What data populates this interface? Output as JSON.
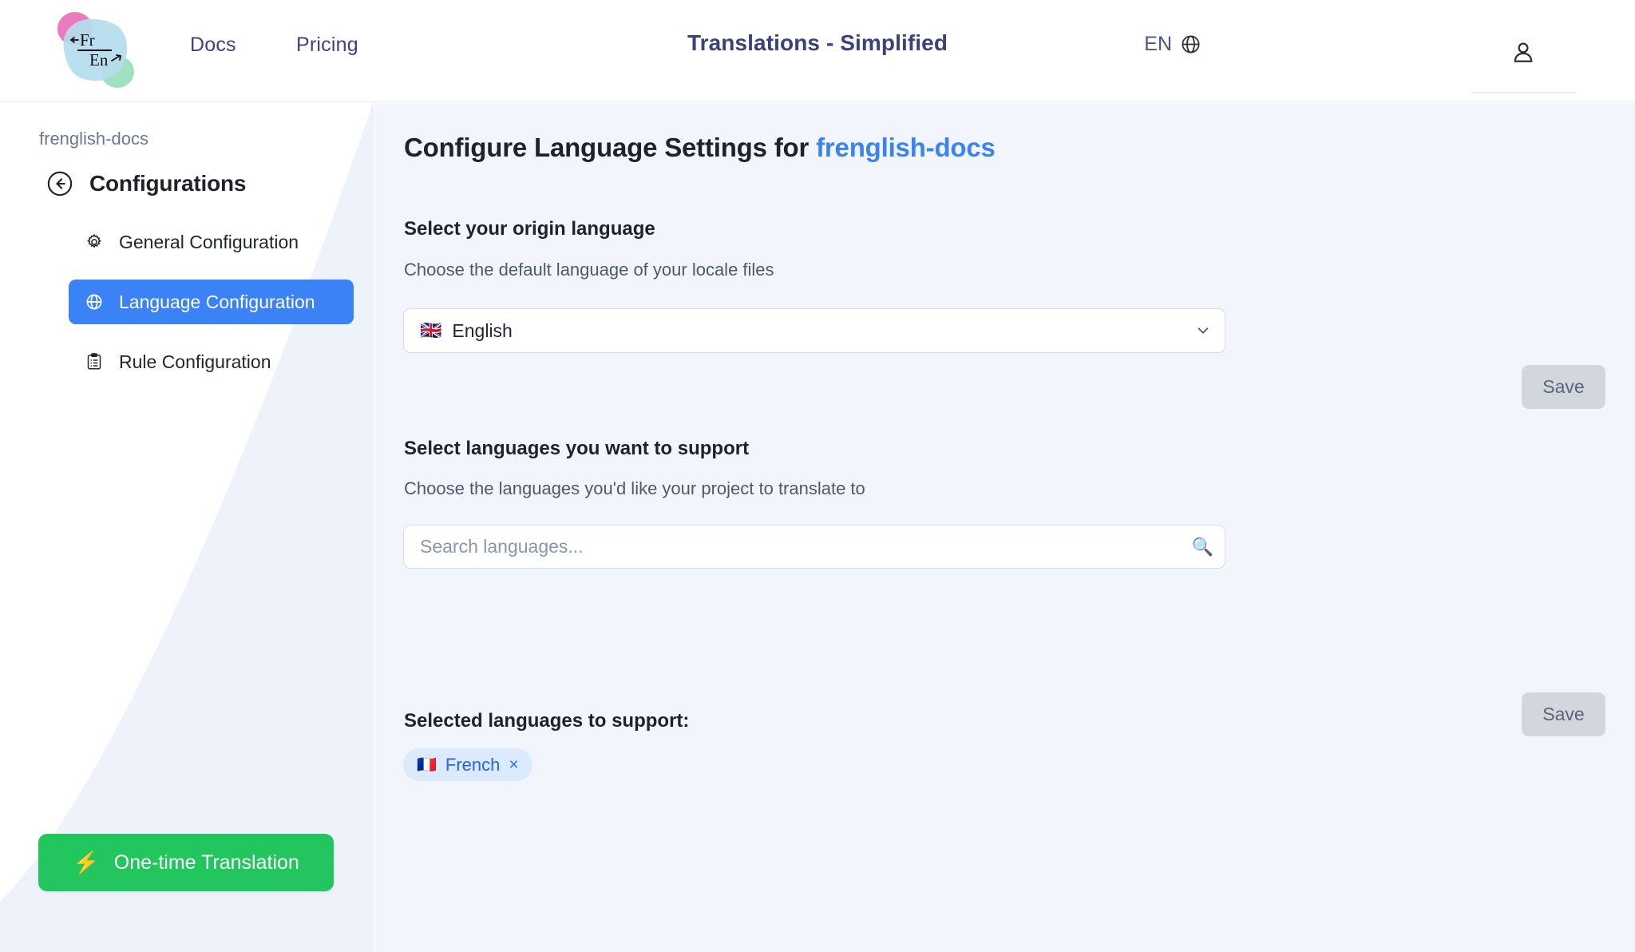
{
  "header": {
    "logo": {
      "name": "frenglish-logo",
      "numerator": "Fr",
      "denominator": "En",
      "blob_main_color": "#b4dced",
      "blob_pink_color": "#ea70b7",
      "blob_green_color": "#a8e0c0"
    },
    "nav": [
      {
        "label": "Docs",
        "name": "nav-docs"
      },
      {
        "label": "Pricing",
        "name": "nav-pricing"
      }
    ],
    "title": "Translations - Simplified",
    "title_color": "#3b4279",
    "language_switcher": {
      "label": "EN",
      "icon": "globe-icon"
    },
    "account": {
      "icon": "user-icon"
    }
  },
  "sidebar": {
    "breadcrumb": "frenglish-docs",
    "heading": "Configurations",
    "back_icon": "arrow-left-circle-icon",
    "items": [
      {
        "label": "General Configuration",
        "icon": "gear-icon",
        "selected": false
      },
      {
        "label": "Language Configuration",
        "icon": "globe-icon",
        "selected": true
      },
      {
        "label": "Rule Configuration",
        "icon": "clipboard-list-icon",
        "selected": false
      }
    ],
    "selected_color": "#3b82f6",
    "cta": {
      "label": "One-time Translation",
      "icon": "lightning-bolt-icon",
      "color": "#22c55e"
    }
  },
  "main": {
    "title_prefix": "Configure Language Settings for ",
    "title_project": "frenglish-docs",
    "project_color": "#3b82f6",
    "origin_section": {
      "title": "Select your origin language",
      "subtitle": "Choose the default language of your locale files",
      "selected_value": "English",
      "selected_flag": "🇬🇧",
      "chevron_icon": "chevron-down-icon",
      "save_label": "Save"
    },
    "support_section": {
      "title": "Select languages you want to support",
      "subtitle": "Choose the languages you'd like your project to translate to",
      "search_placeholder": "Search languages...",
      "search_value": "",
      "search_icon": "search-icon",
      "selected_title": "Selected languages to support:",
      "selected_languages": [
        {
          "label": "French",
          "flag": "🇫🇷",
          "remove_icon": "close-icon"
        }
      ],
      "save_label": "Save"
    }
  }
}
